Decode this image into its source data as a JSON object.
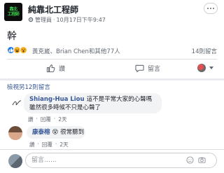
{
  "post": {
    "page_name": "純靠北工程師",
    "page_logo_text": "靠北\n工程師",
    "author_role": "管理員",
    "separator": "·",
    "timestamp": "10月17日下午9:47",
    "text": "幹"
  },
  "reactions": {
    "types": [
      "like-icon",
      "haha-icon",
      "wow-icon"
    ],
    "summary": "黃克崴、Brian Chen和其他77人",
    "comments_count": "14則留言"
  },
  "actions": {
    "like_label": "讚",
    "comment_label": "留言"
  },
  "comments": {
    "view_previous": "檢視另12則留言",
    "items": [
      {
        "author": "Shiang-Hua Liou",
        "text_line1": "這不是平常大家的心聲嗎",
        "text_line2": "雖然很多時候不只是心聲了",
        "like_label": "讚",
        "reply_label": "回覆",
        "separator": "·",
        "time": "2天"
      },
      {
        "author": "康泰榕",
        "emoji": "😵",
        "text": "很常聽到",
        "like_label": "讚",
        "reply_label": "回覆",
        "separator": "·",
        "time": "2天"
      }
    ]
  },
  "composer": {
    "placeholder": "留言……"
  },
  "colors": {
    "link_blue": "#385898",
    "like_blue": "#1877f2",
    "muted_text": "#606770",
    "bubble_bg": "#f2f3f5"
  }
}
